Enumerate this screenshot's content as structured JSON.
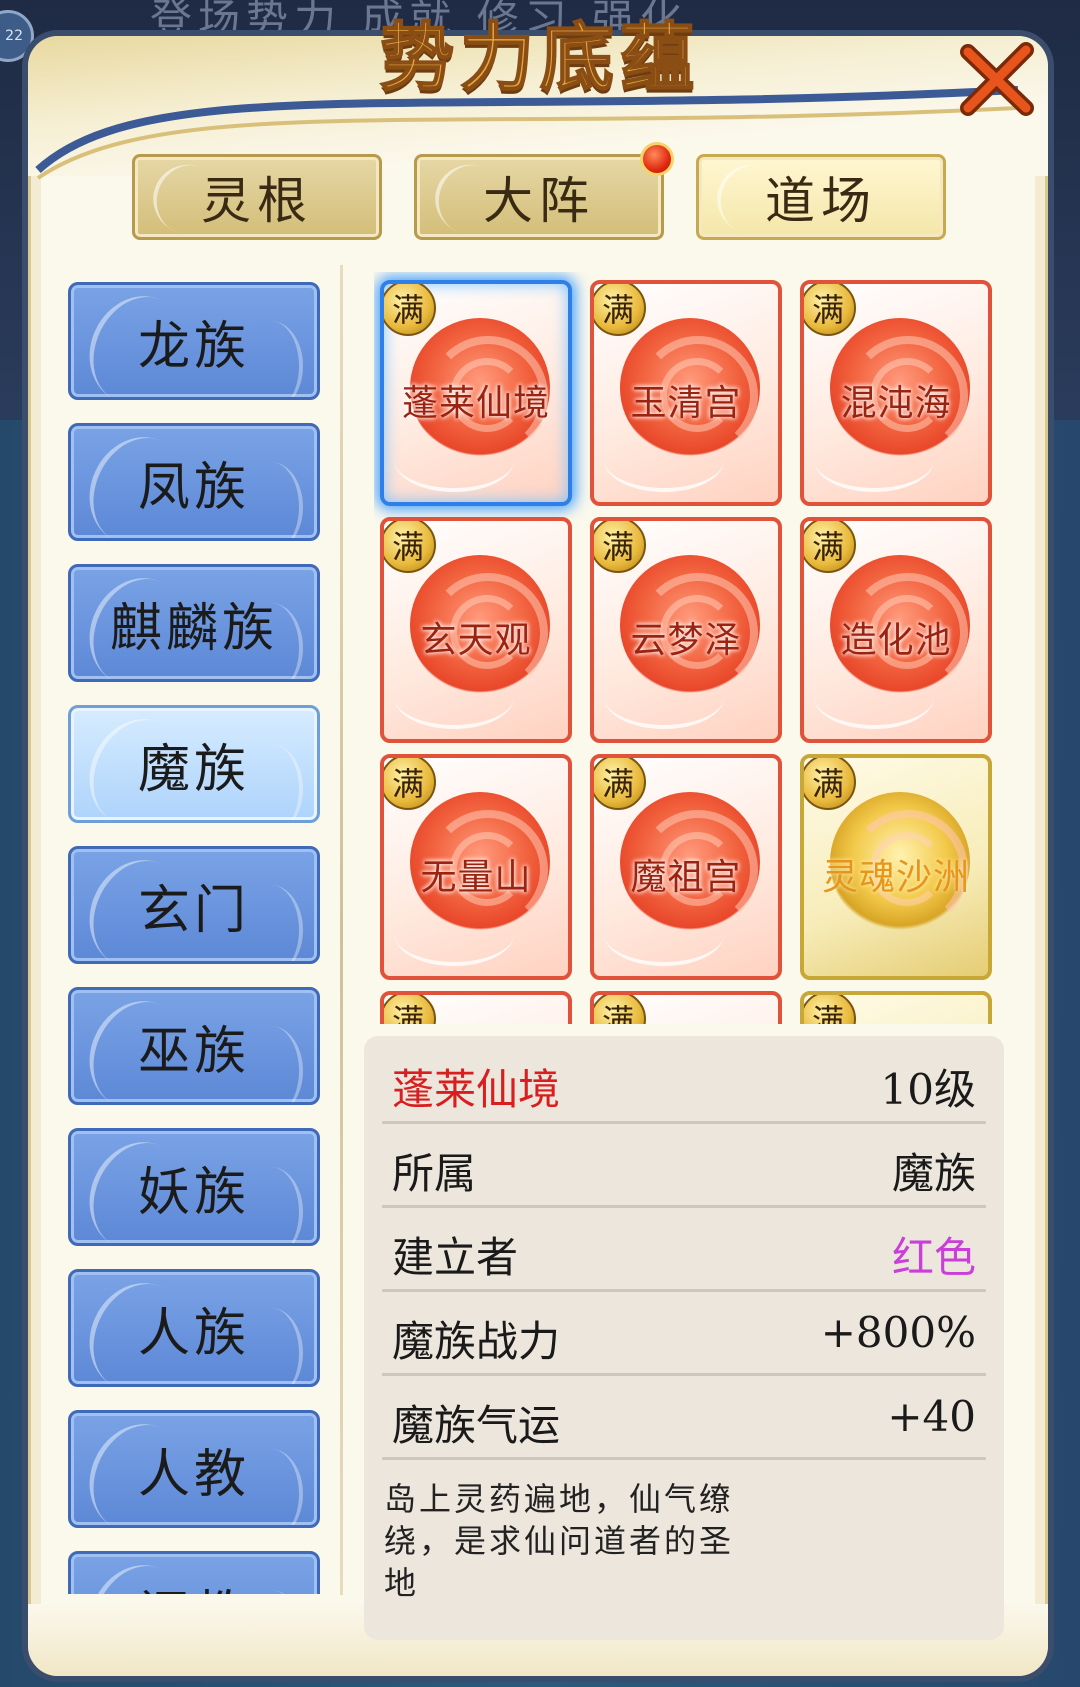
{
  "background": {
    "top_text": "登场势力   成就   修习   强化",
    "badge": "22"
  },
  "title": "势力底蕴",
  "tabs": [
    {
      "label": "灵根",
      "active": false,
      "has_dot": false
    },
    {
      "label": "大阵",
      "active": false,
      "has_dot": true
    },
    {
      "label": "道场",
      "active": true,
      "has_dot": false
    }
  ],
  "sidebar": {
    "items": [
      {
        "label": "龙族",
        "active": false
      },
      {
        "label": "凤族",
        "active": false
      },
      {
        "label": "麒麟族",
        "active": false
      },
      {
        "label": "魔族",
        "active": true
      },
      {
        "label": "玄门",
        "active": false
      },
      {
        "label": "巫族",
        "active": false
      },
      {
        "label": "妖族",
        "active": false
      },
      {
        "label": "人族",
        "active": false
      },
      {
        "label": "人教",
        "active": false
      },
      {
        "label": "阐教",
        "active": false
      }
    ]
  },
  "grid": {
    "badge": "满",
    "cards": [
      {
        "name": "蓬莱仙境",
        "selected": true,
        "gold": false
      },
      {
        "name": "玉清宫",
        "selected": false,
        "gold": false
      },
      {
        "name": "混沌海",
        "selected": false,
        "gold": false
      },
      {
        "name": "玄天观",
        "selected": false,
        "gold": false
      },
      {
        "name": "云梦泽",
        "selected": false,
        "gold": false
      },
      {
        "name": "造化池",
        "selected": false,
        "gold": false
      },
      {
        "name": "无量山",
        "selected": false,
        "gold": false
      },
      {
        "name": "魔祖宫",
        "selected": false,
        "gold": false
      },
      {
        "name": "灵魂沙洲",
        "selected": false,
        "gold": true
      },
      {
        "name": "",
        "selected": false,
        "gold": false
      },
      {
        "name": "",
        "selected": false,
        "gold": false
      },
      {
        "name": "",
        "selected": false,
        "gold": true
      }
    ]
  },
  "info": {
    "name": "蓬莱仙境",
    "level": "10级",
    "rows": [
      {
        "key": "所属",
        "value": "魔族"
      },
      {
        "key": "建立者",
        "value": "红色"
      },
      {
        "key": "魔族战力",
        "value": "+800%"
      },
      {
        "key": "魔族气运",
        "value": "+40"
      }
    ],
    "description": "岛上灵药遍地，仙气缭绕，是求仙问道者的圣地"
  },
  "colors": {
    "name_red": "#d81e1e",
    "founder_purple": "#c93fd8",
    "title_gold": "#e3a83f",
    "sidebar_blue": "#6a93dc",
    "card_red": "#e0533a"
  }
}
